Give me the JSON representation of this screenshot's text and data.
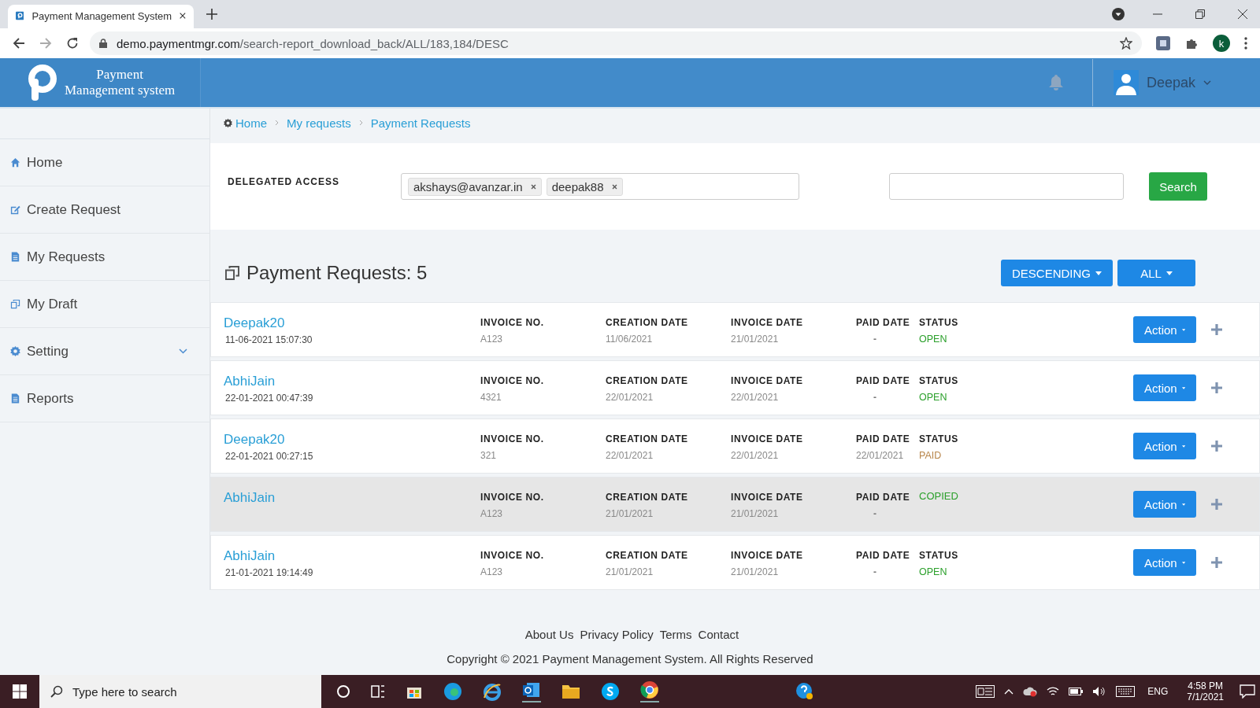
{
  "browser": {
    "tab_title": "Payment Management System",
    "url_host": "demo.paymentmgr.com",
    "url_path": "/search-report_download_back/ALL/183,184/DESC",
    "profile_initial": "k"
  },
  "header": {
    "logo_line1": "Payment",
    "logo_line2": "Management system",
    "user": "Deepak"
  },
  "breadcrumb": [
    "Home",
    "My requests",
    "Payment Requests"
  ],
  "sidebar": {
    "items": [
      {
        "label": "Home",
        "kind": "link"
      },
      {
        "label": "Create Request",
        "kind": "link"
      },
      {
        "label": "My Requests",
        "kind": "link"
      },
      {
        "label": "My Draft",
        "kind": "link"
      },
      {
        "label": "Setting",
        "kind": "expandable"
      },
      {
        "label": "Reports",
        "kind": "link"
      }
    ]
  },
  "delegated": {
    "label": "DELEGATED ACCESS",
    "tags": [
      "akshays@avanzar.in",
      "deepak88"
    ],
    "search_button": "Search"
  },
  "requests": {
    "title": "Payment Requests: 5",
    "sort": "DESCENDING",
    "filter": "ALL",
    "rows": [
      {
        "name": "Deepak20",
        "datetime": "11-06-2021 15:07:30",
        "invoice_label": "INVOICE NO.",
        "invoice": "A123",
        "creation_label": "CREATION DATE",
        "creation": "11/06/2021",
        "invoice_date_label": "INVOICE DATE",
        "invoice_date": "21/01/2021",
        "paid_label": "PAID DATE",
        "paid": "-",
        "status_label": "STATUS",
        "status": "OPEN",
        "color": "#2ca02c",
        "selected": false,
        "action": "Action"
      },
      {
        "name": "AbhiJain",
        "datetime": "22-01-2021 00:47:39",
        "invoice_label": "INVOICE NO.",
        "invoice": "4321",
        "creation_label": "CREATION DATE",
        "creation": "22/01/2021",
        "invoice_date_label": "INVOICE DATE",
        "invoice_date": "22/01/2021",
        "paid_label": "PAID DATE",
        "paid": "-",
        "status_label": "STATUS",
        "status": "OPEN",
        "color": "#2ca02c",
        "selected": false,
        "action": "Action"
      },
      {
        "name": "Deepak20",
        "datetime": "22-01-2021 00:27:15",
        "invoice_label": "INVOICE NO.",
        "invoice": "321",
        "creation_label": "CREATION DATE",
        "creation": "22/01/2021",
        "invoice_date_label": "INVOICE DATE",
        "invoice_date": "22/01/2021",
        "paid_label": "PAID DATE",
        "paid": "22/01/2021",
        "status_label": "STATUS",
        "status": "PAID",
        "color": "#b8864b",
        "selected": false,
        "action": "Action"
      },
      {
        "name": "AbhiJain",
        "invoice_label": "INVOICE NO.",
        "invoice": "A123",
        "creation_label": "CREATION DATE",
        "creation": "21/01/2021",
        "invoice_date_label": "INVOICE DATE",
        "invoice_date": "21/01/2021",
        "paid_label": "PAID DATE",
        "paid": "-",
        "status": "COPIED",
        "color": "#2ca02c",
        "selected": true,
        "action": "Action"
      },
      {
        "name": "AbhiJain",
        "datetime": "21-01-2021 19:14:49",
        "invoice_label": "INVOICE NO.",
        "invoice": "A123",
        "creation_label": "CREATION DATE",
        "creation": "21/01/2021",
        "invoice_date_label": "INVOICE DATE",
        "invoice_date": "21/01/2021",
        "paid_label": "PAID DATE",
        "paid": "-",
        "status_label": "STATUS",
        "status": "OPEN",
        "color": "#2ca02c",
        "selected": false,
        "action": "Action"
      }
    ]
  },
  "footer": {
    "links": [
      "About Us",
      "Privacy Policy",
      "Terms",
      "Contact"
    ],
    "copyright": "Copyright © 2021 Payment Management System. All Rights Reserved"
  },
  "taskbar": {
    "search_placeholder": "Type here to search",
    "language": "ENG",
    "time": "4:58 PM",
    "date": "7/1/2021"
  }
}
